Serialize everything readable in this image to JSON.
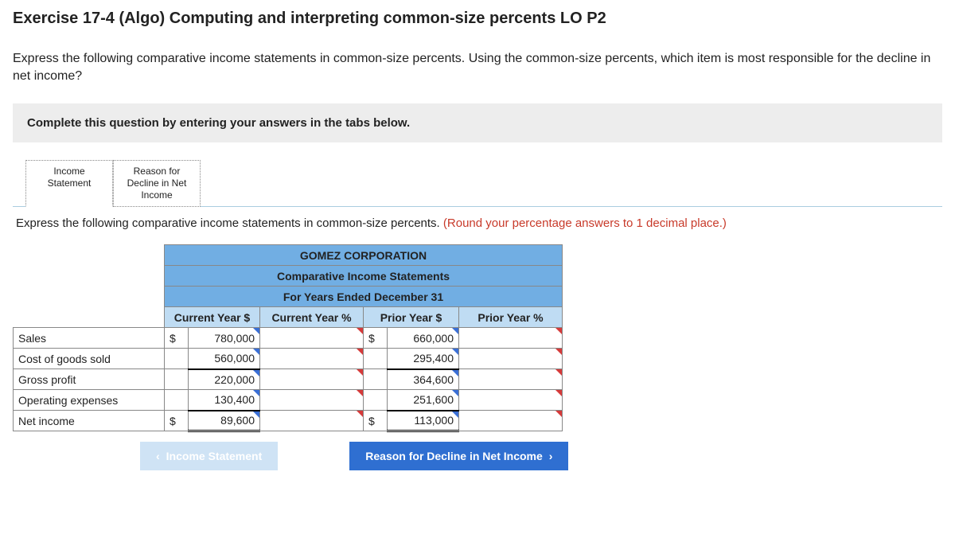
{
  "title": "Exercise 17-4 (Algo) Computing and interpreting common-size percents LO P2",
  "question": "Express the following comparative income statements in common-size percents. Using the common-size percents, which item is most responsible for the decline in net income?",
  "instruction": "Complete this question by entering your answers in the tabs below.",
  "tabs": [
    {
      "label": "Income Statement"
    },
    {
      "label": "Reason for Decline in Net Income"
    }
  ],
  "tab_desc_main": "Express the following comparative income statements in common-size percents. ",
  "tab_desc_hint": "(Round your percentage answers to 1 decimal place.)",
  "table": {
    "corp": "GOMEZ CORPORATION",
    "subtitle": "Comparative Income Statements",
    "period": "For Years Ended December 31",
    "cols": {
      "cy_dollar": "Current Year $",
      "cy_pct": "Current Year %",
      "py_dollar": "Prior Year $",
      "py_pct": "Prior Year %"
    },
    "rows": [
      {
        "label": "Sales",
        "cy_sym": "$",
        "cy": "780,000",
        "py_sym": "$",
        "py": "660,000"
      },
      {
        "label": "Cost of goods sold",
        "cy_sym": "",
        "cy": "560,000",
        "py_sym": "",
        "py": "295,400"
      },
      {
        "label": "Gross profit",
        "cy_sym": "",
        "cy": "220,000",
        "py_sym": "",
        "py": "364,600"
      },
      {
        "label": "Operating expenses",
        "cy_sym": "",
        "cy": "130,400",
        "py_sym": "",
        "py": "251,600"
      },
      {
        "label": "Net income",
        "cy_sym": "$",
        "cy": "89,600",
        "py_sym": "$",
        "py": "113,000"
      }
    ]
  },
  "nav": {
    "prev": "Income Statement",
    "next": "Reason for Decline in Net Income"
  },
  "chart_data": {
    "type": "table",
    "title": "GOMEZ CORPORATION Comparative Income Statements For Years Ended December 31",
    "columns": [
      "Item",
      "Current Year $",
      "Current Year %",
      "Prior Year $",
      "Prior Year %"
    ],
    "rows": [
      [
        "Sales",
        780000,
        null,
        660000,
        null
      ],
      [
        "Cost of goods sold",
        560000,
        null,
        295400,
        null
      ],
      [
        "Gross profit",
        220000,
        null,
        364600,
        null
      ],
      [
        "Operating expenses",
        130400,
        null,
        251600,
        null
      ],
      [
        "Net income",
        89600,
        null,
        113000,
        null
      ]
    ]
  }
}
